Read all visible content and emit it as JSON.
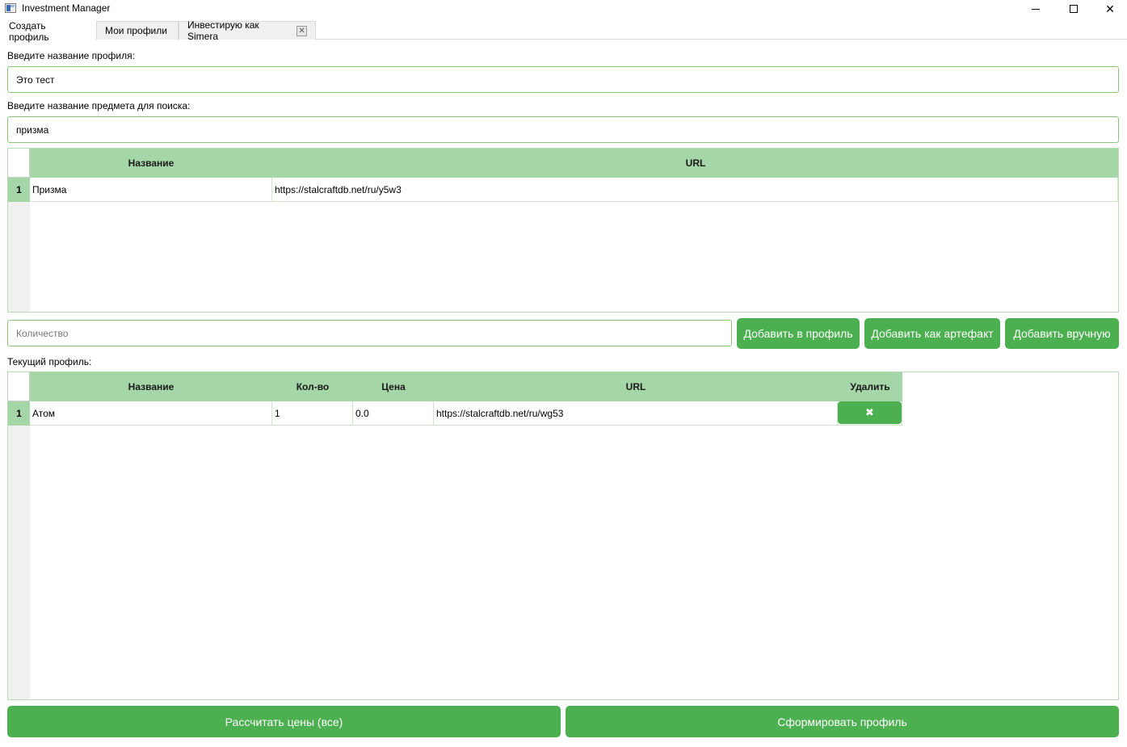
{
  "window": {
    "title": "Investment Manager",
    "minimize_symbol": "",
    "close_symbol": "✕"
  },
  "tabs": [
    {
      "label": "Создать профиль",
      "active": true
    },
    {
      "label": "Мои профили",
      "active": false
    },
    {
      "label": "Инвестирую как Simera",
      "active": false,
      "closable": true,
      "close_symbol": "✕"
    }
  ],
  "form": {
    "profile_name_label": "Введите название профиля:",
    "profile_name_value": "Это тест",
    "search_label": "Введите название предмета для поиска:",
    "search_value": "призма",
    "quantity_placeholder": "Количество"
  },
  "search_table": {
    "columns": [
      "Название",
      "URL"
    ],
    "rows": [
      {
        "num": "1",
        "name": "Призма",
        "url": "https://stalcraftdb.net/ru/y5w3"
      }
    ]
  },
  "actions": {
    "add_to_profile": "Добавить в профиль",
    "add_as_artifact": "Добавить как артефакт",
    "add_manually": "Добавить вручную"
  },
  "current_profile": {
    "label": "Текущий профиль:",
    "columns": [
      "Название",
      "Кол-во",
      "Цена",
      "URL",
      "Удалить"
    ],
    "rows": [
      {
        "num": "1",
        "name": "Атом",
        "qty": "1",
        "price": "0.0",
        "url": "https://stalcraftdb.net/ru/wg53",
        "delete_symbol": "✖"
      }
    ]
  },
  "footer": {
    "calc_prices": "Рассчитать цены (все)",
    "form_profile": "Сформировать профиль"
  },
  "colors": {
    "accent": "#4caf50",
    "header_bg": "#a5d6a7",
    "field_border": "#8bc37e"
  }
}
